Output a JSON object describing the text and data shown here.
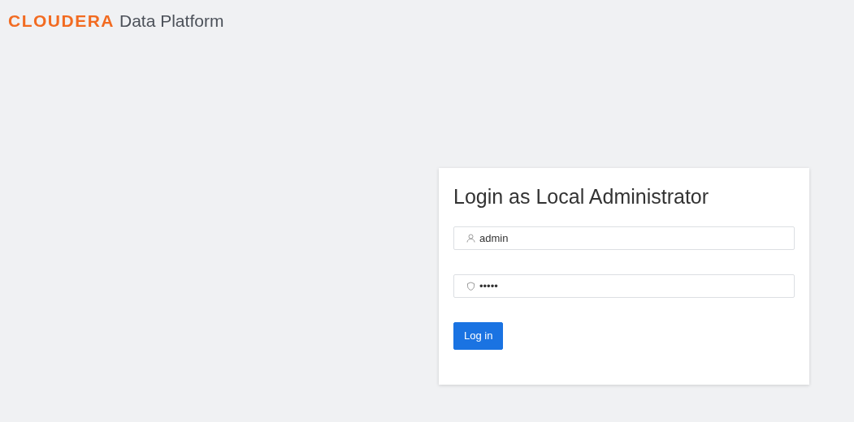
{
  "header": {
    "brand": "CLOUDERA",
    "product": "Data Platform"
  },
  "login": {
    "title": "Login as Local Administrator",
    "fields": [
      {
        "kind": "user",
        "value": "admin"
      },
      {
        "kind": "password",
        "value": "•••••"
      }
    ],
    "button": "Log in"
  }
}
